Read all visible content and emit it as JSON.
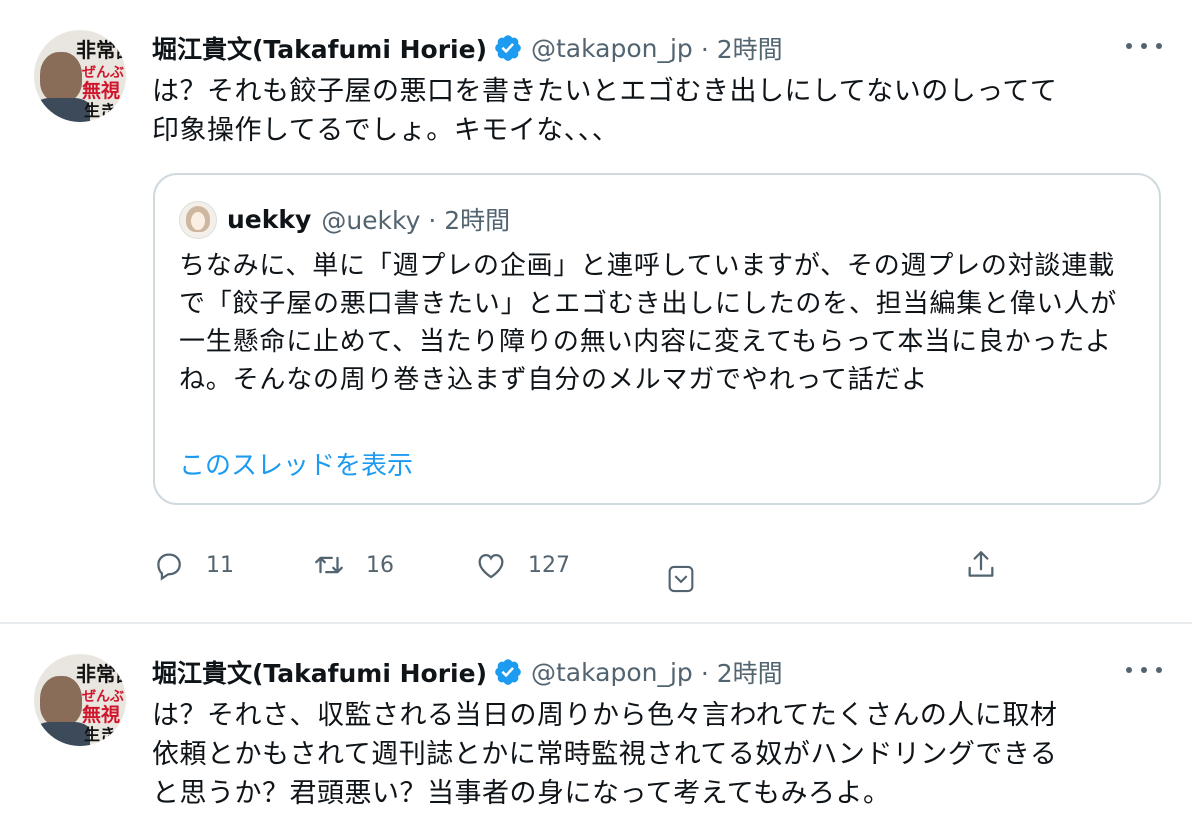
{
  "tweets": [
    {
      "author": {
        "name": "堀江貴文(Takafumi Horie)",
        "handle": "@takapon_jp",
        "time": "· 2時間"
      },
      "text": "は？それも餃子屋の悪口を書きたいとエゴむき出しにしてないのしってて\n印象操作してるでしょ。キモイな、、、",
      "quote": {
        "author": {
          "name": "uekky",
          "handle": "@uekky · 2時間"
        },
        "text": "ちなみに、単に「週プレの企画」と連呼していますが、その週プレの対談連載で「餃子屋の悪口書きたい」とエゴむき出しにしたのを、担当編集と偉い人が一生懸命に止めて、当たり障りの無い内容に変えてもらって本当に良かったよね。そんなの周り巻き込まず自分のメルマガでやれって話だよ",
        "thread_link": "このスレッドを表示"
      },
      "counts": {
        "replies": "11",
        "retweets": "16",
        "likes": "127"
      }
    },
    {
      "author": {
        "name": "堀江貴文(Takafumi Horie)",
        "handle": "@takapon_jp",
        "time": "· 2時間"
      },
      "text": "は？それさ、収監される当日の周りから色々言われてたくさんの人に取材\n依頼とかもされて週刊誌とかに常時監視されてる奴がハンドリングできる\nと思うか？君頭悪い？当事者の身になって考えてもみろよ。"
    }
  ],
  "avatar_text": [
    "非常識",
    "ぜんぶ",
    "無視",
    "生き"
  ],
  "colors": {
    "accent": "#1d9bf0",
    "secondary_text": "#536471",
    "border": "#cfd9de"
  },
  "icons": [
    "verified-badge-icon",
    "more-icon",
    "reply-icon",
    "retweet-icon",
    "like-icon",
    "chevron-down-icon",
    "share-icon"
  ]
}
